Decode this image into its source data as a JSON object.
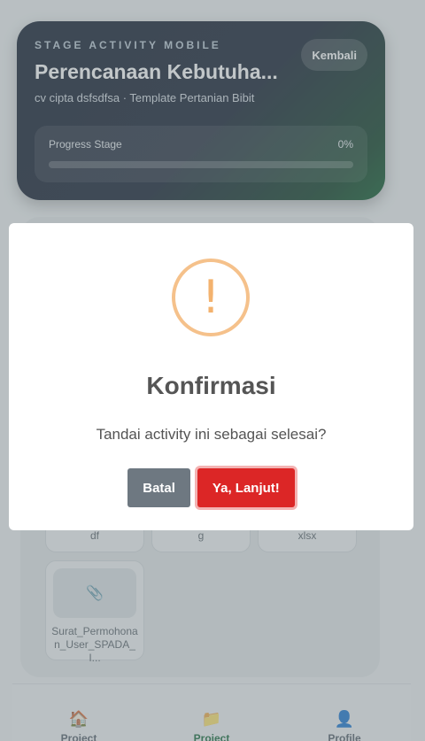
{
  "header": {
    "eyebrow": "STAGE ACTIVITY MOBILE",
    "title": "Perencanaan Kebutuha...",
    "subtitle": "cv cipta dsfsdfsa · Template Pertanian Bibit",
    "back_label": "Kembali",
    "progress_label": "Progress Stage",
    "progress_value": "0%",
    "progress_fraction": 0
  },
  "files": [
    {
      "name": "df"
    },
    {
      "name": "g"
    },
    {
      "name": "xlsx"
    },
    {
      "name": "Surat_Permohonan_User_SPADA_I...",
      "icon": "paperclip-icon"
    }
  ],
  "nav": {
    "items": [
      {
        "label": "Project",
        "icon": "house-icon"
      },
      {
        "label": "Project",
        "icon": "folder-icon"
      },
      {
        "label": "Profile",
        "icon": "user-icon"
      }
    ]
  },
  "modal": {
    "icon": "!",
    "title": "Konfirmasi",
    "text": "Tandai activity ini sebagai selesai?",
    "cancel_label": "Batal",
    "confirm_label": "Ya, Lanjut!"
  },
  "colors": {
    "accent": "#dc2626",
    "cancel": "#6e7881",
    "warning": "#f5c18b",
    "active_nav": "#176b3b"
  }
}
